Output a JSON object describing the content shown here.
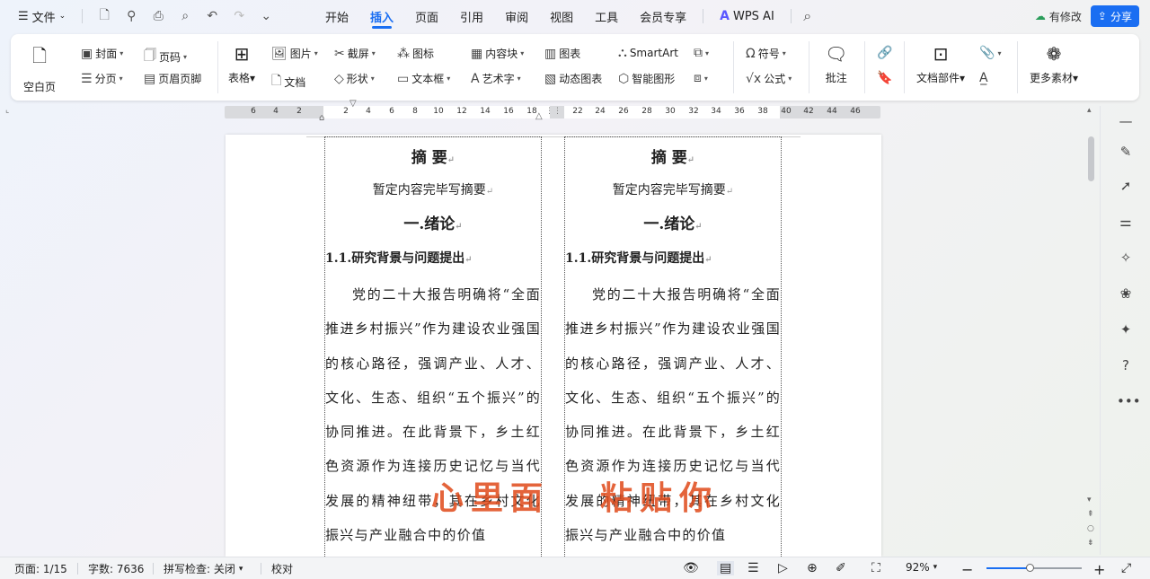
{
  "menu": {
    "file_label": "文件",
    "tabs": [
      "开始",
      "插入",
      "页面",
      "引用",
      "审阅",
      "视图",
      "工具",
      "会员专享"
    ],
    "ai_label": "WPS AI",
    "has_change_label": "有修改",
    "share_label": "分享",
    "icons": [
      "save-icon",
      "export-icon",
      "print-icon",
      "preview-icon",
      "undo-icon",
      "redo-icon",
      "more-icon",
      "search-icon"
    ]
  },
  "ribbon": {
    "blank_page": "空白页",
    "cover": "封面",
    "page_break": "分页",
    "page_number": "页码",
    "header_footer": "页眉页脚",
    "table": "表格",
    "picture": "图片",
    "document": "文档",
    "screenshot": "截屏",
    "shape": "形状",
    "icon": "图标",
    "textbox": "文本框",
    "content_block": "内容块",
    "wordart": "艺术字",
    "chart": "图表",
    "dynamic_chart": "动态图表",
    "smartart": "SmartArt",
    "smart_shape": "智能图形",
    "symbol": "符号",
    "formula": "公式",
    "comment": "批注",
    "doc_parts": "文档部件",
    "more_materials": "更多素材"
  },
  "ruler": {
    "left_numbers": [
      "6",
      "4",
      "2"
    ],
    "col1_numbers": [
      "2",
      "4",
      "6",
      "8",
      "10",
      "12",
      "14",
      "16",
      "18"
    ],
    "col2_numbers": [
      "22",
      "24",
      "26",
      "28",
      "30",
      "32",
      "34",
      "36",
      "38"
    ],
    "right_numbers": [
      "40",
      "42",
      "44",
      "46"
    ]
  },
  "document": {
    "abstract_title": "摘 要",
    "abstract_text": "暂定内容完毕写摘要",
    "chapter_title": "一.绪论",
    "section_title": "1.1.研究背景与问题提出",
    "paragraph": "党的二十大报告明确将“全面推进乡村振兴”作为建设农业强国的核心路径，强调产业、人才、文化、生态、组织“五个振兴”的协同推进。在此背景下，乡土红色资源作为连接历史记忆与当代发展的精神纽带，其在乡村文化振兴与产业融合中的价值"
  },
  "watermark": {
    "part1": "心里面",
    "part2": "粘贴你"
  },
  "status": {
    "page": "页面: 1/15",
    "word_count": "字数: 7636",
    "spell_check": "拼写检查: 关闭",
    "proofread": "校对",
    "zoom": "92%",
    "zoom_fraction": 0.45
  },
  "colors": {
    "accent": "#1a6ef2",
    "watermark": "#e04a1a"
  }
}
